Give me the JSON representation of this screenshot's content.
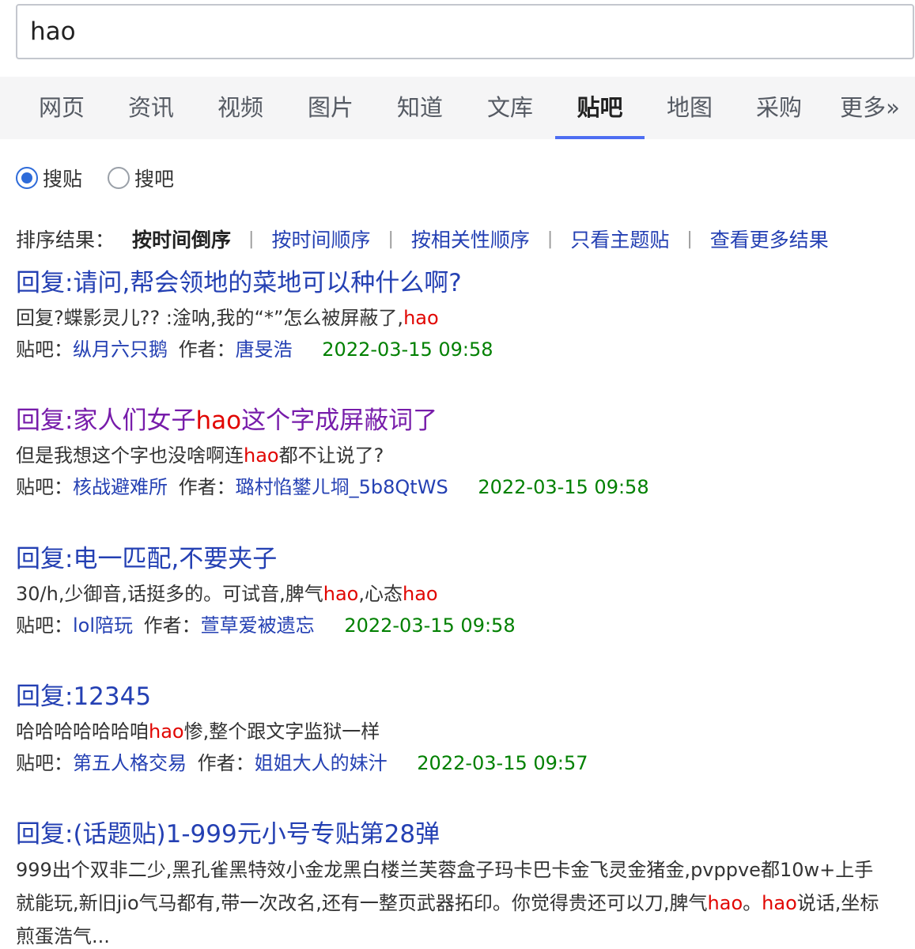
{
  "search": {
    "query": "hao"
  },
  "tabs": [
    {
      "label": "网页"
    },
    {
      "label": "资讯"
    },
    {
      "label": "视频"
    },
    {
      "label": "图片"
    },
    {
      "label": "知道"
    },
    {
      "label": "文库"
    },
    {
      "label": "贴吧"
    },
    {
      "label": "地图"
    },
    {
      "label": "采购"
    },
    {
      "label": "更多»"
    }
  ],
  "active_tab": "贴吧",
  "radio": {
    "option1": "搜贴",
    "option2": "搜吧",
    "selected": "搜贴"
  },
  "sort": {
    "prefix": "排序结果：",
    "current": "按时间倒序",
    "links": [
      "按时间顺序",
      "按相关性顺序",
      "只看主题贴",
      "查看更多结果"
    ],
    "separator": "|"
  },
  "meta_labels": {
    "bar": "贴吧：",
    "author": "作者："
  },
  "results": [
    {
      "title": "回复:请问,帮会领地的菜地可以种什么啊?",
      "abstract_pre": "回复?蝶影灵儿?? :淦呐,我的“*”怎么被屏蔽了,",
      "abstract_em": "hao",
      "bar": "纵月六只鹅",
      "author": "唐旻浩",
      "time": "2022-03-15 09:58"
    },
    {
      "title_pre": "回复:家人们女子",
      "title_em": "hao",
      "title_post": "这个字成屏蔽词了",
      "abstract_pre": "但是我想这个字也没啥啊连",
      "abstract_em": "hao",
      "abstract_post": "都不让说了?",
      "bar": "核战避难所",
      "author": "璐村惂鐢ㄦ埛_5b8QtWS",
      "time": "2022-03-15 09:58"
    },
    {
      "title": "回复:电一匹配,不要夹子",
      "abstract_pre": "30/h,少御音,话挺多的。可试音,脾气",
      "abstract_em1": "hao",
      "abstract_mid": ",心态",
      "abstract_em2": "hao",
      "bar": "lol陪玩",
      "author": "萱草爱被遗忘",
      "time": "2022-03-15 09:58"
    },
    {
      "title": "回复:12345",
      "abstract_pre": "哈哈哈哈哈哈咱",
      "abstract_em": "hao",
      "abstract_post": "惨,整个跟文字监狱一样",
      "bar": "第五人格交易",
      "author": "姐姐大人的妹汁",
      "time": "2022-03-15 09:57"
    },
    {
      "title": "回复:(话题贴)1-999元小号专贴第28弹",
      "abstract_pre": "999出个双非二少,黑孔雀黑特效小金龙黑白楼兰芙蓉盒子玛卡巴卡金飞灵金猪金,pvppve都10w+上手就能玩,新旧jio气马都有,带一次改名,还有一整页武器拓印。你觉得贵还可以刀,脾气",
      "abstract_em1": "hao",
      "abstract_mid": "。",
      "abstract_em2": "hao",
      "abstract_post": "说话,坐标煎蛋浩气..."
    }
  ]
}
